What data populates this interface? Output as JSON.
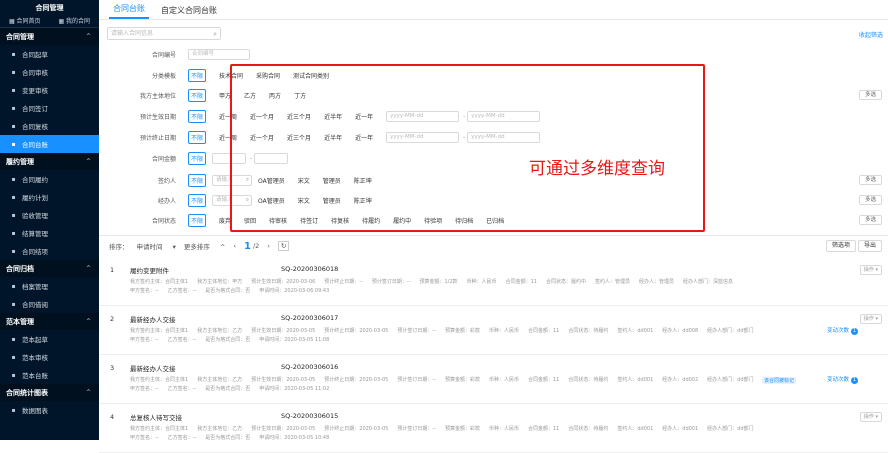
{
  "sidebar": {
    "title": "合同管理",
    "quick": [
      "合同首页",
      "我的合同"
    ],
    "sections": [
      {
        "label": "合同管理",
        "items": [
          "合同起草",
          "合同审核",
          "变更审核",
          "合同签订",
          "合同复核",
          "合同台账"
        ]
      },
      {
        "label": "履约管理",
        "items": [
          "合同履约",
          "履约计划",
          "验收管理",
          "结算管理",
          "合同结项"
        ]
      },
      {
        "label": "合同归档",
        "items": [
          "档案管理",
          "合同借阅"
        ]
      },
      {
        "label": "范本管理",
        "items": [
          "范本起草",
          "范本审核",
          "范本台账"
        ]
      },
      {
        "label": "合同统计图表",
        "items": [
          "数据图表"
        ]
      }
    ]
  },
  "tabs": [
    "合同台账",
    "自定义合同台账"
  ],
  "search_placeholder": "请输入合同信息",
  "collapse_label": "收起筛选",
  "filters": {
    "contract_no": {
      "label": "合同编号",
      "placeholder": "合同编号"
    },
    "category": {
      "label": "分类模板",
      "options": [
        "不限",
        "技术合同",
        "采购合同",
        "测试合同类别"
      ]
    },
    "party": {
      "label": "我方主体地位",
      "options": [
        "不限",
        "甲方",
        "乙方",
        "丙方",
        "丁方"
      ]
    },
    "effective": {
      "label": "预计生效日期",
      "options": [
        "不限",
        "近一周",
        "近一个月",
        "近三个月",
        "近半年",
        "近一年"
      ],
      "placeholder": "yyyy-MM-dd"
    },
    "end": {
      "label": "预计终止日期",
      "options": [
        "不限",
        "近一周",
        "近一个月",
        "近三个月",
        "近半年",
        "近一年"
      ],
      "placeholder": "yyyy-MM-dd"
    },
    "amount": {
      "label": "合同金额",
      "options": [
        "不限"
      ]
    },
    "signer": {
      "label": "签约人",
      "options": [
        "不限"
      ],
      "placeholder": "请输入",
      "names": [
        "OA管理员",
        "宋文",
        "管理员",
        "陈正坤"
      ]
    },
    "handler": {
      "label": "经办人",
      "options": [
        "不限"
      ],
      "placeholder": "请输入",
      "names": [
        "OA管理员",
        "宋文",
        "管理员",
        "陈正坤"
      ]
    },
    "status": {
      "label": "合同状态",
      "options": [
        "不限",
        "废弃",
        "驳回",
        "待审核",
        "待签订",
        "待复核",
        "待履约",
        "履约中",
        "待验项",
        "待归档",
        "已归档"
      ]
    },
    "multi_label": "多选"
  },
  "overlay_text": "可通过多维度查询",
  "sortbar": {
    "sort_label": "排序：",
    "sort_field": "申请时间",
    "more_sort": "更多排序",
    "page_current": "1",
    "page_total": "/2"
  },
  "toolbar": {
    "tag_filter": "筛选项",
    "export": "导出"
  },
  "records": [
    {
      "idx": "1",
      "name": "履约变更附件",
      "code": "SQ-20200306018",
      "line1": [
        "我方签约主体：合同主体1",
        "我方主体地位：甲方",
        "预计生效日期：2020-03-06",
        "预计终止日期：--",
        "预计签订日期：--",
        "预算金额：1/2款",
        "币种：人民币",
        "合同金额：11",
        "合同状态：履约中",
        "签约人：管理员",
        "经办人：管理员",
        "经办人部门：深蓝信息"
      ],
      "line2": [
        "甲方签名：--",
        "乙方签名：--",
        "是否为格式合同：否",
        "申请时间：2020-03-06 09:43"
      ],
      "action": "操作",
      "link": "",
      "tag": ""
    },
    {
      "idx": "2",
      "name": "最新经办人交接",
      "code": "SQ-20200306017",
      "line1": [
        "我方签约主体：合同主体1",
        "我方主体地位：乙方",
        "预计生效日期：2020-03-05",
        "预计终止日期：2020-03-05",
        "预计签订日期：--",
        "预算金额：彩款",
        "币种：人民币",
        "合同金额：11",
        "合同状态：待履约",
        "签约人：dd001",
        "经办人：dd008",
        "经办人部门：dd部门"
      ],
      "line2": [
        "甲方签名：--",
        "乙方签名：--",
        "是否为格式合同：否",
        "申请时间：2020-03-05 11:08"
      ],
      "action": "操作",
      "link": "变动次数",
      "tag": ""
    },
    {
      "idx": "3",
      "name": "最新经办人交接",
      "code": "SQ-20200306016",
      "line1": [
        "我方签约主体：合同主体1",
        "我方主体地位：乙方",
        "预计生效日期：2020-03-05",
        "预计终止日期：2020-03-05",
        "预计签订日期：--",
        "预算金额：彩款",
        "币种：人民币",
        "合同金额：11",
        "合同状态：待履约",
        "签约人：dd001",
        "经办人：dd002",
        "经办人部门：dd部门"
      ],
      "line2": [
        "甲方签名：--",
        "乙方签名：--",
        "是否为格式合同：否",
        "申请时间：2020-03-05 11:02"
      ],
      "action": "",
      "link": "变动次数",
      "tag": "该合同被标记"
    },
    {
      "idx": "4",
      "name": "总复核人待写交接",
      "code": "SQ-20200306015",
      "line1": [
        "我方签约主体：合同主体1",
        "我方主体地位：乙方",
        "预计生效日期：2020-03-05",
        "预计终止日期：2020-03-05",
        "预计签订日期：--",
        "预算金额：彩款",
        "币种：人民币",
        "合同金额：11",
        "合同状态：待履约",
        "签约人：dd001",
        "经办人：dd001",
        "经办人部门：dd部门"
      ],
      "line2": [
        "甲方签名：--",
        "乙方签名：--",
        "是否为格式合同：否",
        "申请时间：2020-03-05 10:48"
      ],
      "action": "操作",
      "link": "",
      "tag": ""
    }
  ],
  "colors": {
    "primary": "#1890ff",
    "sidebar": "#001529",
    "highlight": "#e81818"
  }
}
